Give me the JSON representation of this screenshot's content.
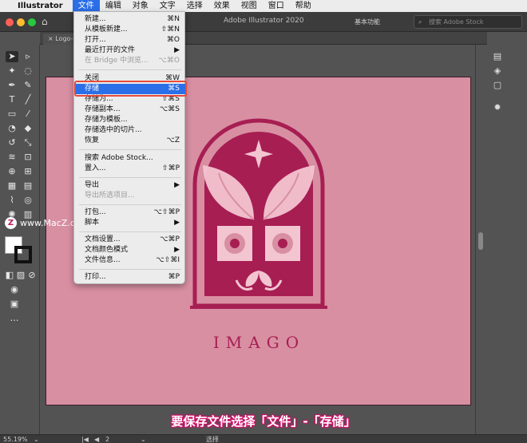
{
  "menubar": {
    "app_name": "Illustrator",
    "items": [
      "文件",
      "编辑",
      "对象",
      "文字",
      "选择",
      "效果",
      "视图",
      "窗口",
      "帮助"
    ]
  },
  "appbar": {
    "title": "Adobe Illustrator 2020",
    "workspace": "基本功能",
    "stock_placeholder": "搜索 Adobe Stock"
  },
  "tab": {
    "label": "Logo-d"
  },
  "file_menu": {
    "items": [
      {
        "label": "新建...",
        "shortcut": "⌘N",
        "disabled": false
      },
      {
        "label": "从模板新建...",
        "shortcut": "⇧⌘N",
        "disabled": false
      },
      {
        "label": "打开...",
        "shortcut": "⌘O",
        "disabled": false
      },
      {
        "label": "最近打开的文件",
        "shortcut": "▶",
        "disabled": false
      },
      {
        "label": "在 Bridge 中浏览...",
        "shortcut": "⌥⌘O",
        "disabled": true
      },
      {
        "label": "关闭",
        "shortcut": "⌘W",
        "disabled": false
      },
      {
        "label": "存储",
        "shortcut": "⌘S",
        "disabled": false
      },
      {
        "label": "存储为...",
        "shortcut": "⇧⌘S",
        "disabled": false
      },
      {
        "label": "存储副本...",
        "shortcut": "⌥⌘S",
        "disabled": false
      },
      {
        "label": "存储为模板...",
        "shortcut": "",
        "disabled": false
      },
      {
        "label": "存储选中的切片...",
        "shortcut": "",
        "disabled": false
      },
      {
        "label": "恢复",
        "shortcut": "⌥Z",
        "disabled": false
      },
      {
        "label": "搜索 Adobe Stock...",
        "shortcut": "",
        "disabled": false
      },
      {
        "label": "置入...",
        "shortcut": "⇧⌘P",
        "disabled": false
      },
      {
        "label": "导出",
        "shortcut": "▶",
        "disabled": false
      },
      {
        "label": "导出所选项目...",
        "shortcut": "",
        "disabled": true
      },
      {
        "label": "打包...",
        "shortcut": "⌥⇧⌘P",
        "disabled": false
      },
      {
        "label": "脚本",
        "shortcut": "▶",
        "disabled": false
      },
      {
        "label": "文档设置...",
        "shortcut": "⌥⌘P",
        "disabled": false
      },
      {
        "label": "文档颜色模式",
        "shortcut": "▶",
        "disabled": false
      },
      {
        "label": "文件信息...",
        "shortcut": "⌥⇧⌘I",
        "disabled": false
      },
      {
        "label": "打印...",
        "shortcut": "⌘P",
        "disabled": false
      }
    ]
  },
  "artboard": {
    "logo_text": "IMAGO"
  },
  "watermark": {
    "text": "www.MacZ.com"
  },
  "statusbar": {
    "zoom": "55.19%",
    "page": "2",
    "tool": "选择"
  },
  "caption": "要保存文件选择「文件」-「存储」",
  "colors": {
    "artboard": "#d88fa2",
    "logo_dark": "#a71e53",
    "logo_light": "#f3c5d1",
    "menu_highlight": "#2a6ee8",
    "highlight_box": "#e84a3a"
  }
}
